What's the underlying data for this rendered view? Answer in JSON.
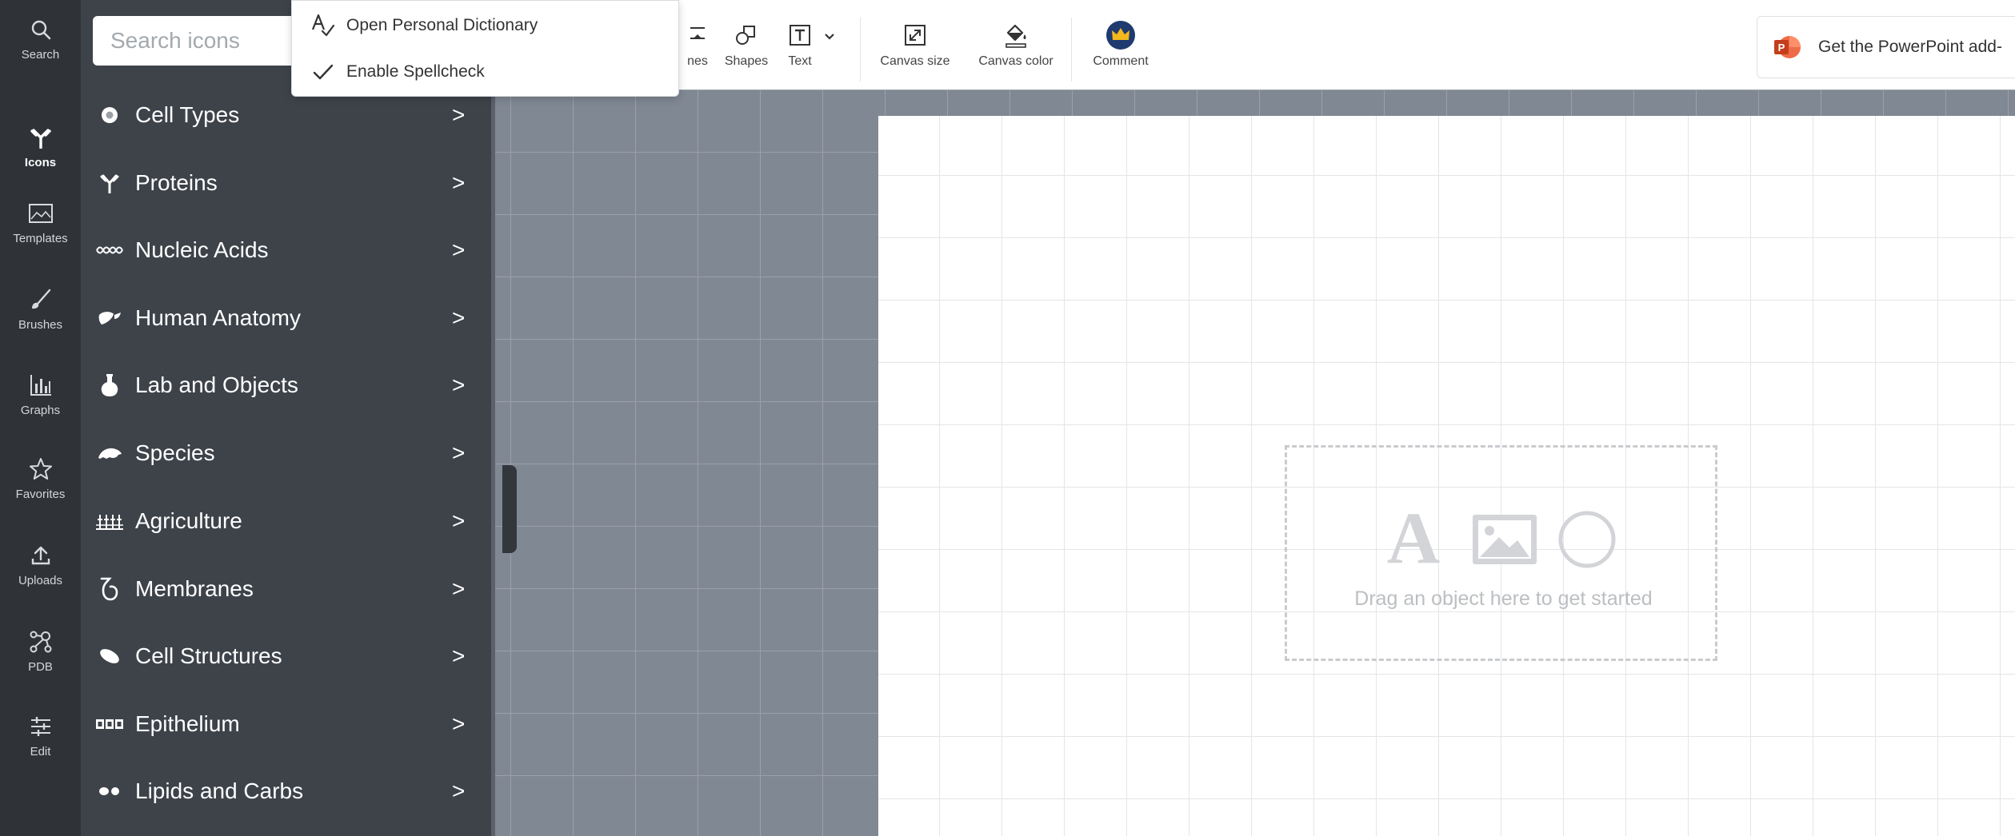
{
  "rail": {
    "items": [
      {
        "label": "Search",
        "icon": "search-icon",
        "active": false
      },
      {
        "label": "Icons",
        "icon": "antibody-icon",
        "active": true
      },
      {
        "label": "Templates",
        "icon": "template-icon",
        "active": false
      },
      {
        "label": "Brushes",
        "icon": "brush-icon",
        "active": false
      },
      {
        "label": "Graphs",
        "icon": "bar-graph-icon",
        "active": false
      },
      {
        "label": "Favorites",
        "icon": "star-icon",
        "active": false
      },
      {
        "label": "Uploads",
        "icon": "upload-icon",
        "active": false
      },
      {
        "label": "PDB",
        "icon": "molecule-icon",
        "active": false
      },
      {
        "label": "Edit",
        "icon": "sliders-icon",
        "active": false
      }
    ]
  },
  "panel": {
    "search_placeholder": "Search icons",
    "categories": [
      {
        "label": "Cell Types",
        "icon": "cell-icon"
      },
      {
        "label": "Proteins",
        "icon": "protein-icon"
      },
      {
        "label": "Nucleic Acids",
        "icon": "dna-wave-icon"
      },
      {
        "label": "Human Anatomy",
        "icon": "organ-icon"
      },
      {
        "label": "Lab and Objects",
        "icon": "flask-icon"
      },
      {
        "label": "Species",
        "icon": "animal-icon"
      },
      {
        "label": "Agriculture",
        "icon": "crop-icon"
      },
      {
        "label": "Membranes",
        "icon": "membrane-icon"
      },
      {
        "label": "Cell Structures",
        "icon": "organelle-icon"
      },
      {
        "label": "Epithelium",
        "icon": "epithelium-icon"
      },
      {
        "label": "Lipids and Carbs",
        "icon": "lipid-icon"
      }
    ],
    "chevron": ">"
  },
  "context_menu": {
    "items": [
      {
        "label": "Open Personal Dictionary",
        "icon": "spellcheck-icon"
      },
      {
        "label": "Enable Spellcheck",
        "icon": "checkmark-icon"
      }
    ]
  },
  "toolbar": {
    "lines_label": "nes",
    "shapes_label": "Shapes",
    "text_label": "Text",
    "canvas_size_label": "Canvas size",
    "canvas_color_label": "Canvas color",
    "comment_label": "Comment",
    "ppt_label": "Get the PowerPoint add-",
    "ppt_logo_letter": "P"
  },
  "canvas": {
    "drop_hint": "Drag an object here to get started",
    "drop_letter": "A"
  },
  "colors": {
    "rail_bg": "#2f3338",
    "panel_bg": "#3e434a",
    "workspace_bg": "#808894",
    "ppt_red": "#d24726",
    "crown_blue": "#1f3a6e",
    "crown_gold": "#f4b81c"
  }
}
